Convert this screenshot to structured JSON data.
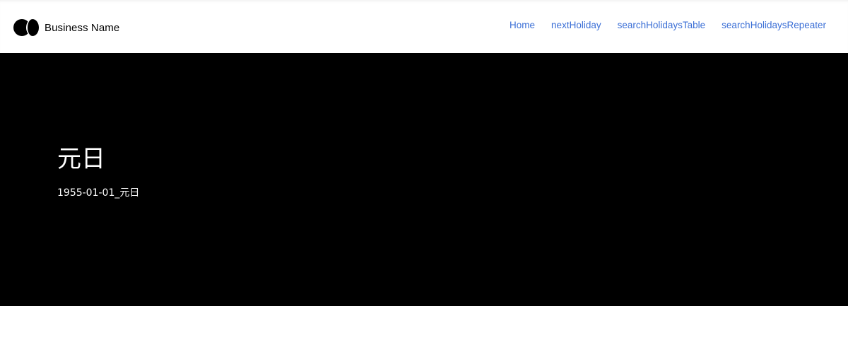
{
  "header": {
    "brand_name": "Business Name",
    "logo_icon": "two-circles-logo-icon",
    "nav": [
      {
        "label": "Home"
      },
      {
        "label": "nextHoliday"
      },
      {
        "label": "searchHolidaysTable"
      },
      {
        "label": "searchHolidaysRepeater"
      }
    ]
  },
  "hero": {
    "title": "元日",
    "subtitle": "1955-01-01_元日"
  },
  "colors": {
    "nav_link": "#3b6fd6",
    "hero_background": "#000000",
    "hero_text": "#ffffff"
  }
}
